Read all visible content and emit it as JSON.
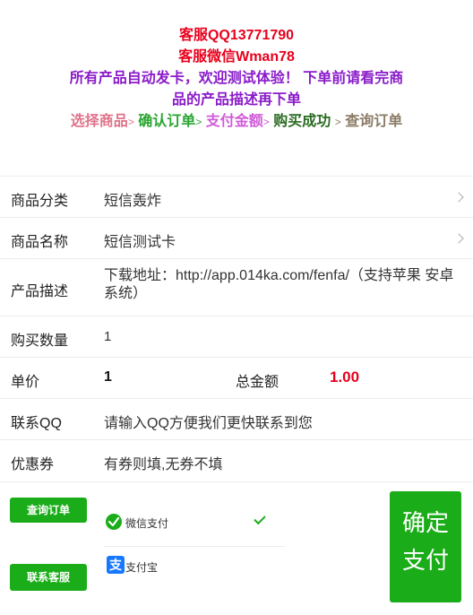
{
  "notice": {
    "qq": "客服QQ13771790",
    "wechat": "客服微信Wman78",
    "message_line1": "所有产品自动发卡，欢迎测试体验！ 下单前请看完商",
    "message_line2": "品的产品描述再下单",
    "steps": [
      "选择商品",
      "确认订单",
      "支付金额",
      "购买成功",
      "查询订单"
    ],
    "step_arrow": ">"
  },
  "form": {
    "category": {
      "label": "商品分类",
      "value": "短信轰炸"
    },
    "product": {
      "label": "商品名称",
      "value": "短信测试卡"
    },
    "description": {
      "label": "产品描述",
      "value": "下载地址：http://app.014ka.com/fenfa/（支持苹果 安卓系统）"
    },
    "quantity": {
      "label": "购买数量",
      "value": "1"
    },
    "price": {
      "label": "单价",
      "value": "1",
      "total_label": "总金额",
      "total_value": "1.00"
    },
    "contact": {
      "label": "联系QQ",
      "placeholder": "请输入QQ方便我们更快联系到您"
    },
    "coupon": {
      "label": "优惠券",
      "placeholder": "有券则填,无券不填"
    }
  },
  "actions": {
    "query_order": "查询订单",
    "contact_service": "联系客服",
    "confirm_line1": "确定",
    "confirm_line2": "支付"
  },
  "payment": {
    "methods": [
      {
        "name": "微信支付",
        "icon": "wechat-pay-icon",
        "selected": true
      },
      {
        "name": "支付宝",
        "icon": "alipay-icon",
        "selected": false
      }
    ]
  },
  "colors": {
    "accent_green": "#1aad19",
    "total_red": "#e8001c",
    "notice_red": "#e8001c",
    "notice_purple": "#8a1bc9"
  }
}
